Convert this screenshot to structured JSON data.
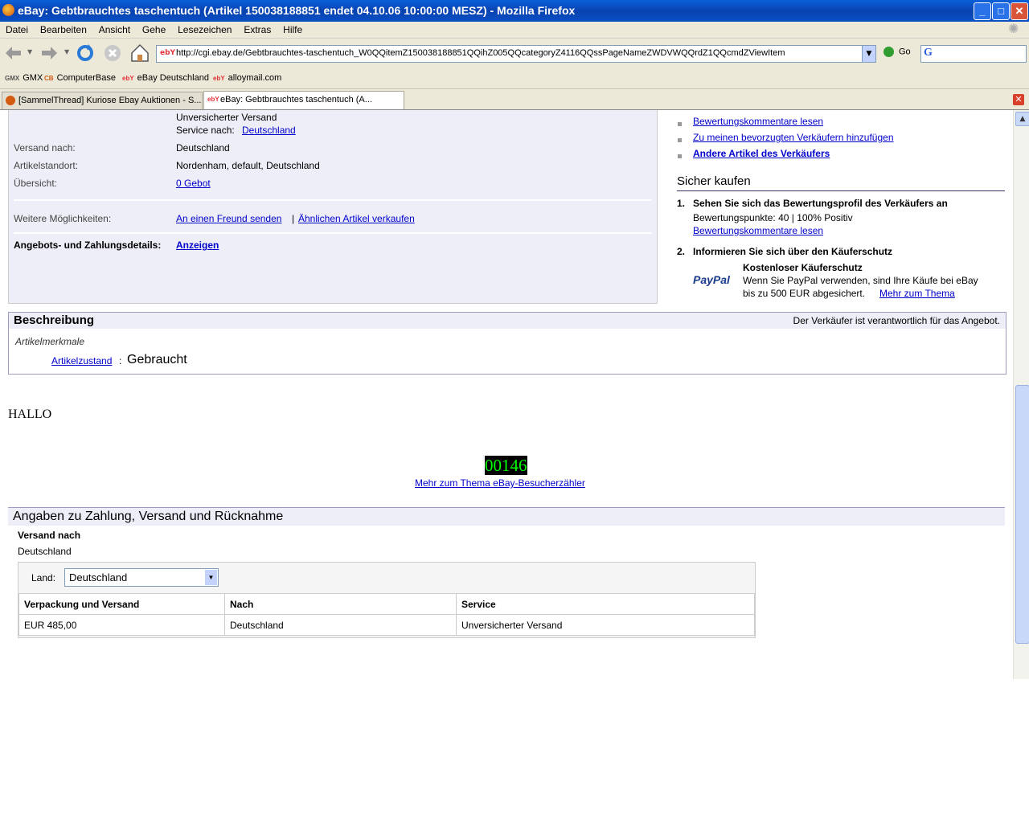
{
  "window": {
    "title": "eBay: Gebtbrauchtes taschentuch (Artikel 150038188851 endet 04.10.06 10:00:00 MESZ) - Mozilla Firefox",
    "min": "_",
    "max": "□",
    "close": "✕"
  },
  "menu": [
    "Datei",
    "Bearbeiten",
    "Ansicht",
    "Gehe",
    "Lesezeichen",
    "Extras",
    "Hilfe"
  ],
  "toolbar": {
    "url": "http://cgi.ebay.de/Gebtbrauchtes-taschentuch_W0QQitemZ150038188851QQihZ005QQcategoryZ4116QQssPageNameZWDVWQQrdZ1QQcmdZViewItem",
    "url_favicon": "ebY",
    "go_label": "Go"
  },
  "bookmarks": [
    {
      "icon": "GMX",
      "label": "GMX"
    },
    {
      "icon": "CB",
      "label": "ComputerBase"
    },
    {
      "icon": "ebY",
      "label": "eBay Deutschland"
    },
    {
      "icon": "ebY",
      "label": "alloymail.com"
    }
  ],
  "tabs": [
    {
      "label": "[SammelThread] Kuriose Ebay Auktionen - S...",
      "active": false
    },
    {
      "label": "eBay: Gebtbrauchtes taschentuch (A...",
      "active": true
    }
  ],
  "info": {
    "shipping_service_line1": "Unversicherter Versand",
    "service_label": "Service nach:",
    "service_value": "Deutschland",
    "versand_label": "Versand nach:",
    "versand_value": "Deutschland",
    "standort_label": "Artikelstandort:",
    "standort_value": "Nordenham, default, Deutschland",
    "uebersicht_label": "Übersicht:",
    "uebersicht_value": "0 Gebot",
    "weitere_label": "Weitere Möglichkeiten:",
    "freund_link": "An einen Freund senden",
    "separator": "|",
    "aehnlich_link": "Ähnlichen Artikel verkaufen",
    "angebot_label": "Angebots- und Zahlungsdetails:",
    "angebot_link": "Anzeigen"
  },
  "right": {
    "link1": "Bewertungskommentare lesen",
    "link2": "Zu meinen bevorzugten Verkäufern hinzufügen",
    "link3": "Andere Artikel des Verkäufers",
    "sicher_title": "Sicher kaufen",
    "step1_num": "1.",
    "step1_title": "Sehen Sie sich das Bewertungsprofil des Verkäufers an",
    "step1_points": "Bewertungspunkte: 40 | 100% Positiv",
    "step1_link": "Bewertungskommentare lesen",
    "step2_num": "2.",
    "step2_title": "Informieren Sie sich über den Käuferschutz",
    "paypal_logo": "PayPal",
    "kaeufer_title": "Kostenloser Käuferschutz",
    "kaeufer_text1": "Wenn Sie PayPal verwenden, sind Ihre Käufe bei eBay",
    "kaeufer_text2": "bis zu 500 EUR abgesichert.",
    "kaeufer_link": "Mehr zum Thema"
  },
  "description": {
    "title": "Beschreibung",
    "responsibility": "Der Verkäufer ist verantwortlich für das Angebot.",
    "merkmale": "Artikelmerkmale",
    "zustand_label": "Artikelzustand",
    "zustand_colon": ":",
    "zustand_value": "Gebraucht",
    "body_text": "HALLO"
  },
  "counter": {
    "value": "00146",
    "link": "Mehr zum Thema eBay-Besucherzähler"
  },
  "payment": {
    "section_title": "Angaben zu Zahlung, Versand und Rücknahme",
    "versand_heading": "Versand nach",
    "versand_value": "Deutschland",
    "land_label": "Land:",
    "land_selected": "Deutschland",
    "columns": [
      "Verpackung und Versand",
      "Nach",
      "Service"
    ],
    "rows": [
      [
        "EUR 485,00",
        "Deutschland",
        "Unversicherter Versand"
      ]
    ]
  },
  "colors": {
    "titlebar": "#0842b0",
    "panel_bg": "#eeeef8",
    "link": "#0000cc",
    "counter_fg": "#00ff00",
    "counter_bg": "#000000"
  }
}
